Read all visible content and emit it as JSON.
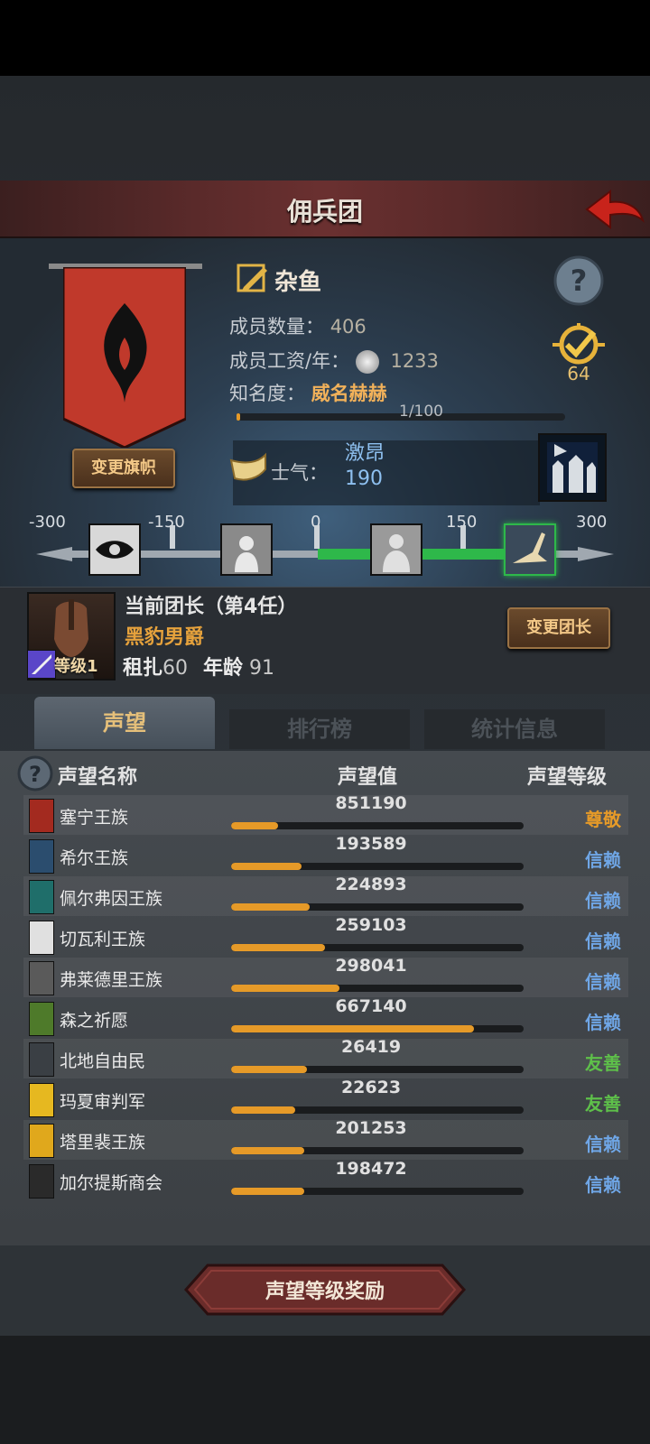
{
  "header": {
    "title": "佣兵团"
  },
  "company": {
    "name": "杂鱼",
    "members_label": "成员数量：",
    "members_value": "406",
    "salary_label": "成员工资/年：",
    "salary_value": "1233",
    "fame_label": "知名度：",
    "fame_value": "威名赫赫",
    "fame_progress": "1/100",
    "fame_fraction": 0.01,
    "badge_count": "64",
    "change_banner_label": "变更旗帜",
    "banner_color": "#c0392b"
  },
  "morale": {
    "label": "士气：",
    "state": "激昂",
    "value": "190",
    "ticks": [
      "-300",
      "-150",
      "0",
      "150",
      "300"
    ]
  },
  "leader": {
    "title": "当前团长（第4任）",
    "name": "黑豹男爵",
    "level_label": "等级1",
    "rent_label": "租扎",
    "rent_value": "60",
    "age_label": "年龄",
    "age_value": "91",
    "change_leader_label": "变更团长"
  },
  "tabs": [
    {
      "label": "声望",
      "active": true
    },
    {
      "label": "排行榜",
      "active": false
    },
    {
      "label": "统计信息",
      "active": false
    }
  ],
  "table": {
    "col_name": "声望名称",
    "col_value": "声望值",
    "col_level": "声望等级",
    "rows": [
      {
        "name": "塞宁王族",
        "value": "851190",
        "fill": 0.16,
        "level": "尊敬",
        "level_color": "#e69a28",
        "icon_color": "#a32a1f"
      },
      {
        "name": "希尔王族",
        "value": "193589",
        "fill": 0.24,
        "level": "信赖",
        "level_color": "#6fa6e6",
        "icon_color": "#2b4d6e"
      },
      {
        "name": "佩尔弗因王族",
        "value": "224893",
        "fill": 0.27,
        "level": "信赖",
        "level_color": "#6fa6e6",
        "icon_color": "#1f6e6a"
      },
      {
        "name": "切瓦利王族",
        "value": "259103",
        "fill": 0.32,
        "level": "信赖",
        "level_color": "#6fa6e6",
        "icon_color": "#e0e0e0"
      },
      {
        "name": "弗莱德里王族",
        "value": "298041",
        "fill": 0.37,
        "level": "信赖",
        "level_color": "#6fa6e6",
        "icon_color": "#5a5a5a"
      },
      {
        "name": "森之祈愿",
        "value": "667140",
        "fill": 0.83,
        "level": "信赖",
        "level_color": "#6fa6e6",
        "icon_color": "#4e7a2a"
      },
      {
        "name": "北地自由民",
        "value": "26419",
        "fill": 0.26,
        "level": "友善",
        "level_color": "#5ec04a",
        "icon_color": "#3a3f44"
      },
      {
        "name": "玛夏审判军",
        "value": "22623",
        "fill": 0.22,
        "level": "友善",
        "level_color": "#5ec04a",
        "icon_color": "#e6b820"
      },
      {
        "name": "塔里裴王族",
        "value": "201253",
        "fill": 0.25,
        "level": "信赖",
        "level_color": "#6fa6e6",
        "icon_color": "#e0a81c"
      },
      {
        "name": "加尔提斯商会",
        "value": "198472",
        "fill": 0.25,
        "level": "信赖",
        "level_color": "#6fa6e6",
        "icon_color": "#2a2a2a"
      }
    ]
  },
  "footer": {
    "reward_label": "声望等级奖励"
  }
}
